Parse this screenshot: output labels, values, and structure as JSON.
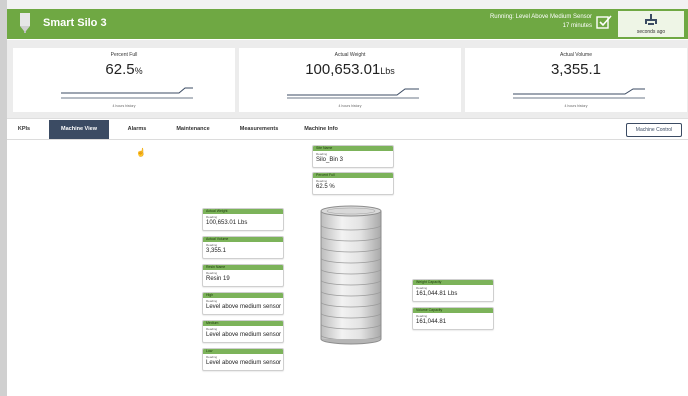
{
  "header": {
    "title": "Smart Silo 3",
    "status_line1": "Running: Level Above Medium Sensor",
    "status_line2": "17 minutes",
    "connection_label": "seconds ago",
    "colors": {
      "header_bg": "#6fa843",
      "tile_head": "#7cb35a",
      "tab_active": "#3b4b63"
    }
  },
  "kpis": [
    {
      "label": "Percent Full",
      "value": "62.5",
      "unit": "%",
      "history": "4 hours history"
    },
    {
      "label": "Actual Weight",
      "value": "100,653.01",
      "unit": "Lbs",
      "history": "4 hours history"
    },
    {
      "label": "Actual Volume",
      "value": "3,355.1",
      "unit": "",
      "history": "4 hours history"
    }
  ],
  "tabs": [
    {
      "label": "KPIs"
    },
    {
      "label": "Machine View",
      "active": true
    },
    {
      "label": "Alarms"
    },
    {
      "label": "Maintenance"
    },
    {
      "label": "Measurements"
    },
    {
      "label": "Machine Info"
    }
  ],
  "machine_control_label": "Machine Control",
  "tiles": {
    "site_name": {
      "title": "Site Name",
      "sub": "Reading",
      "value": "Silo_Bin 3"
    },
    "percent_full": {
      "title": "Percent Full",
      "sub": "Reading",
      "value": "62.5 %"
    },
    "actual_weight": {
      "title": "Actual Weight",
      "sub": "Reading",
      "value": "100,653.01 Lbs"
    },
    "actual_volume": {
      "title": "Actual Volume",
      "sub": "Reading",
      "value": "3,355.1"
    },
    "resin_name": {
      "title": "Resin Name",
      "sub": "Reading",
      "value": "Resin 19"
    },
    "high": {
      "title": "High",
      "sub": "Reading",
      "value": "Level above medium sensor"
    },
    "medium": {
      "title": "Medium",
      "sub": "Reading",
      "value": "Level above medium sensor"
    },
    "low": {
      "title": "Low",
      "sub": "Reading",
      "value": "Level above medium sensor"
    },
    "weight_capacity": {
      "title": "Weight Capacity",
      "sub": "Reading",
      "value": "161,044.81 Lbs"
    },
    "volume_capacity": {
      "title": "Volume Capacity",
      "sub": "Reading",
      "value": "161,044.81"
    }
  }
}
